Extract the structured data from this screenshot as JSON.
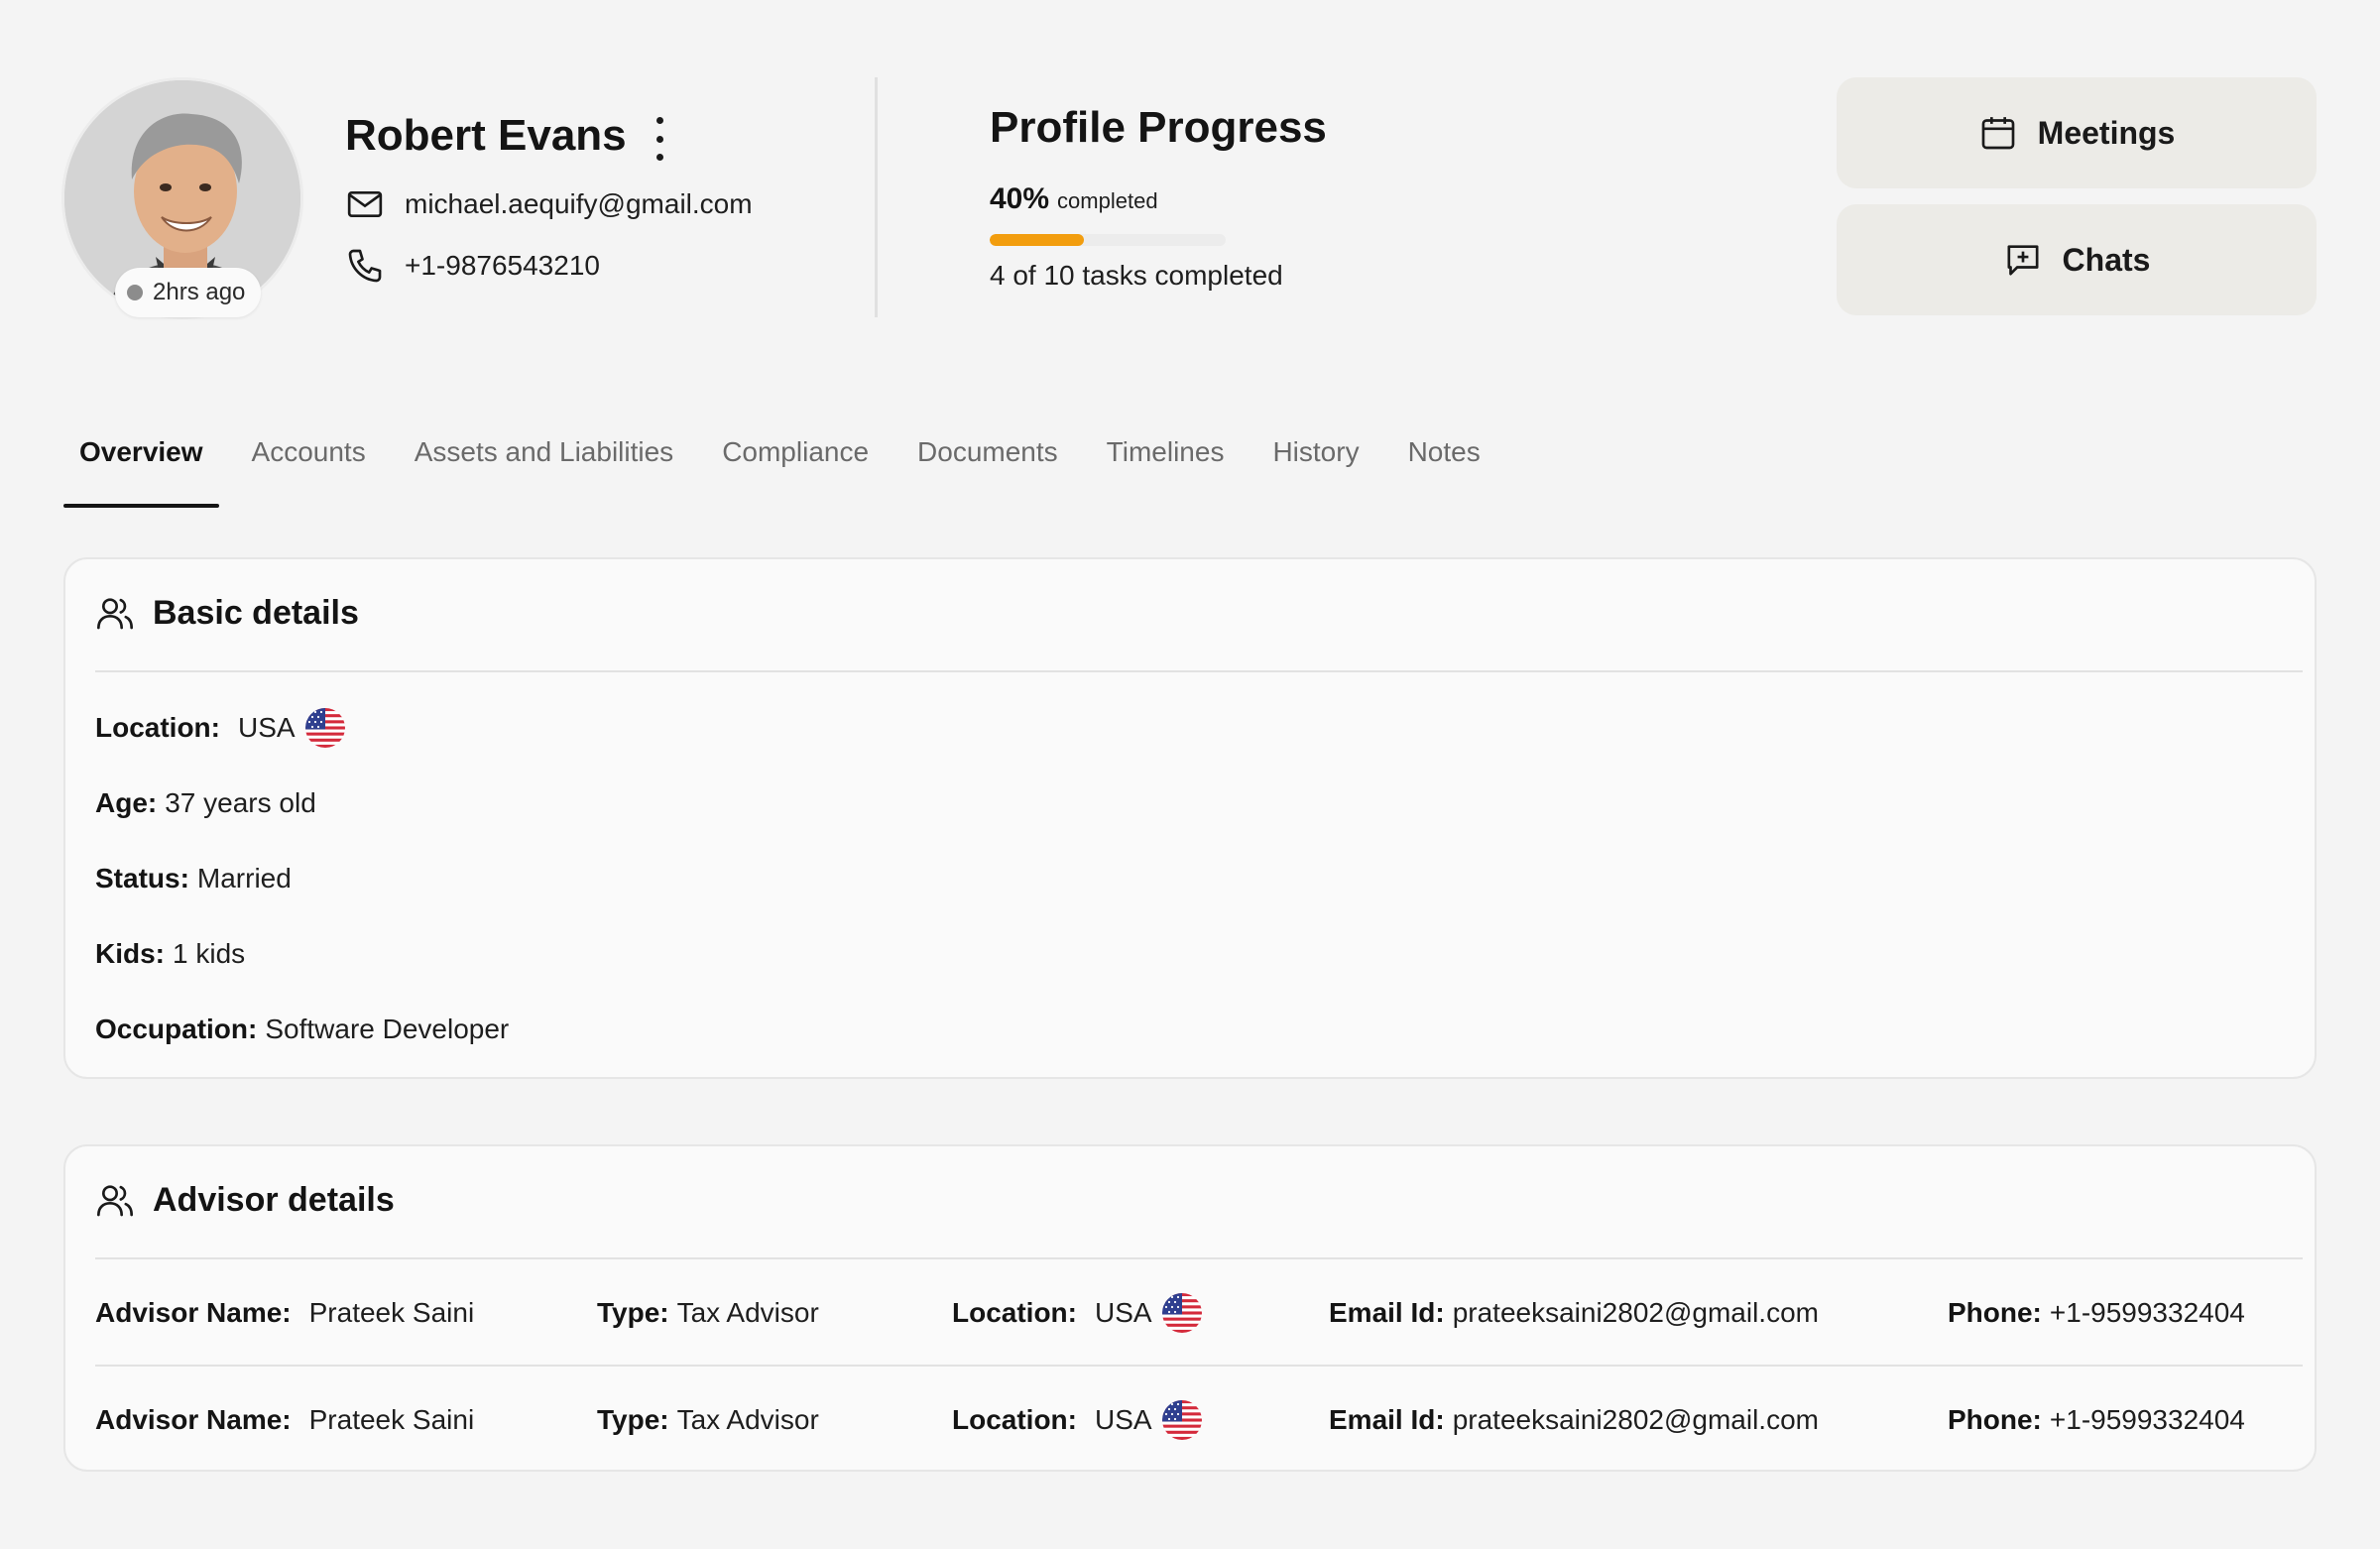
{
  "profile": {
    "name": "Robert Evans",
    "email": "michael.aequify@gmail.com",
    "phone": "+1-9876543210",
    "last_seen": "2hrs ago"
  },
  "progress": {
    "title": "Profile Progress",
    "percent": "40%",
    "percent_value": 40,
    "percent_label": "completed",
    "tasks_text": "4 of 10 tasks completed"
  },
  "actions": {
    "meetings_label": "Meetings",
    "chats_label": "Chats"
  },
  "tabs": [
    {
      "label": "Overview",
      "active": true
    },
    {
      "label": "Accounts"
    },
    {
      "label": "Assets and Liabilities"
    },
    {
      "label": "Compliance"
    },
    {
      "label": "Documents"
    },
    {
      "label": "Timelines"
    },
    {
      "label": "History"
    },
    {
      "label": "Notes"
    }
  ],
  "basic_details": {
    "title": "Basic details",
    "location_label": "Location:",
    "location_value": "USA",
    "age_label": "Age:",
    "age_value": "37 years old",
    "status_label": "Status:",
    "status_value": "Married",
    "kids_label": "Kids:",
    "kids_value": "1 kids",
    "occupation_label": "Occupation:",
    "occupation_value": "Software Developer"
  },
  "advisor_details": {
    "title": "Advisor details",
    "labels": {
      "name": "Advisor Name:",
      "type": "Type:",
      "location": "Location:",
      "email": "Email Id:",
      "phone": "Phone:"
    },
    "rows": [
      {
        "name": "Prateek Saini",
        "type": "Tax Advisor",
        "location": "USA",
        "email": "prateeksaini2802@gmail.com",
        "phone": "+1-9599332404"
      },
      {
        "name": "Prateek Saini",
        "type": "Tax Advisor",
        "location": "USA",
        "email": "prateeksaini2802@gmail.com",
        "phone": "+1-9599332404"
      }
    ]
  },
  "colors": {
    "accent_progress": "#f29d0e",
    "button_bg": "#ecebe7",
    "page_bg": "#f4f4f4"
  },
  "icons": [
    "mail-icon",
    "phone-icon",
    "calendar-icon",
    "chat-plus-icon",
    "users-icon",
    "kebab-menu-icon",
    "us-flag-icon"
  ]
}
